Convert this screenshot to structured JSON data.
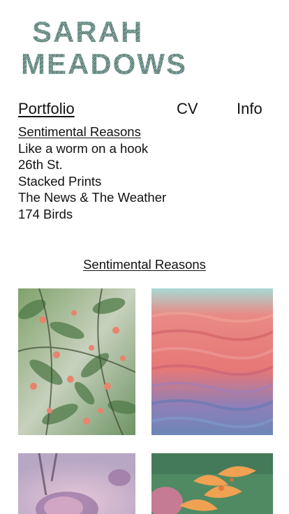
{
  "site": {
    "logo_line1": "SARAH",
    "logo_line2": "MEADOWS"
  },
  "nav": {
    "items": [
      {
        "label": "Portfolio",
        "active": true
      },
      {
        "label": "CV"
      },
      {
        "label": "Info"
      }
    ]
  },
  "portfolio": {
    "series": [
      {
        "label": "Sentimental Reasons",
        "current": true
      },
      {
        "label": "Like a worm on a hook"
      },
      {
        "label": "26th St."
      },
      {
        "label": "Stacked Prints"
      },
      {
        "label": "The News & The Weather"
      },
      {
        "label": "174 Birds"
      }
    ]
  },
  "gallery": {
    "title": "Sentimental Reasons",
    "images": [
      {
        "subject": "peach tree branches",
        "palette": [
          "#6f9a63",
          "#e88873",
          "#cfd6c6"
        ]
      },
      {
        "subject": "red and blue water ripples",
        "palette": [
          "#e97d7d",
          "#7d86c2",
          "#a9d8d6"
        ]
      },
      {
        "subject": "faded purple rose",
        "palette": [
          "#c9a7c8",
          "#8c6f98",
          "#e7cfd8"
        ]
      },
      {
        "subject": "orange lily",
        "palette": [
          "#e89a54",
          "#4e8260",
          "#d2748a"
        ]
      }
    ]
  }
}
